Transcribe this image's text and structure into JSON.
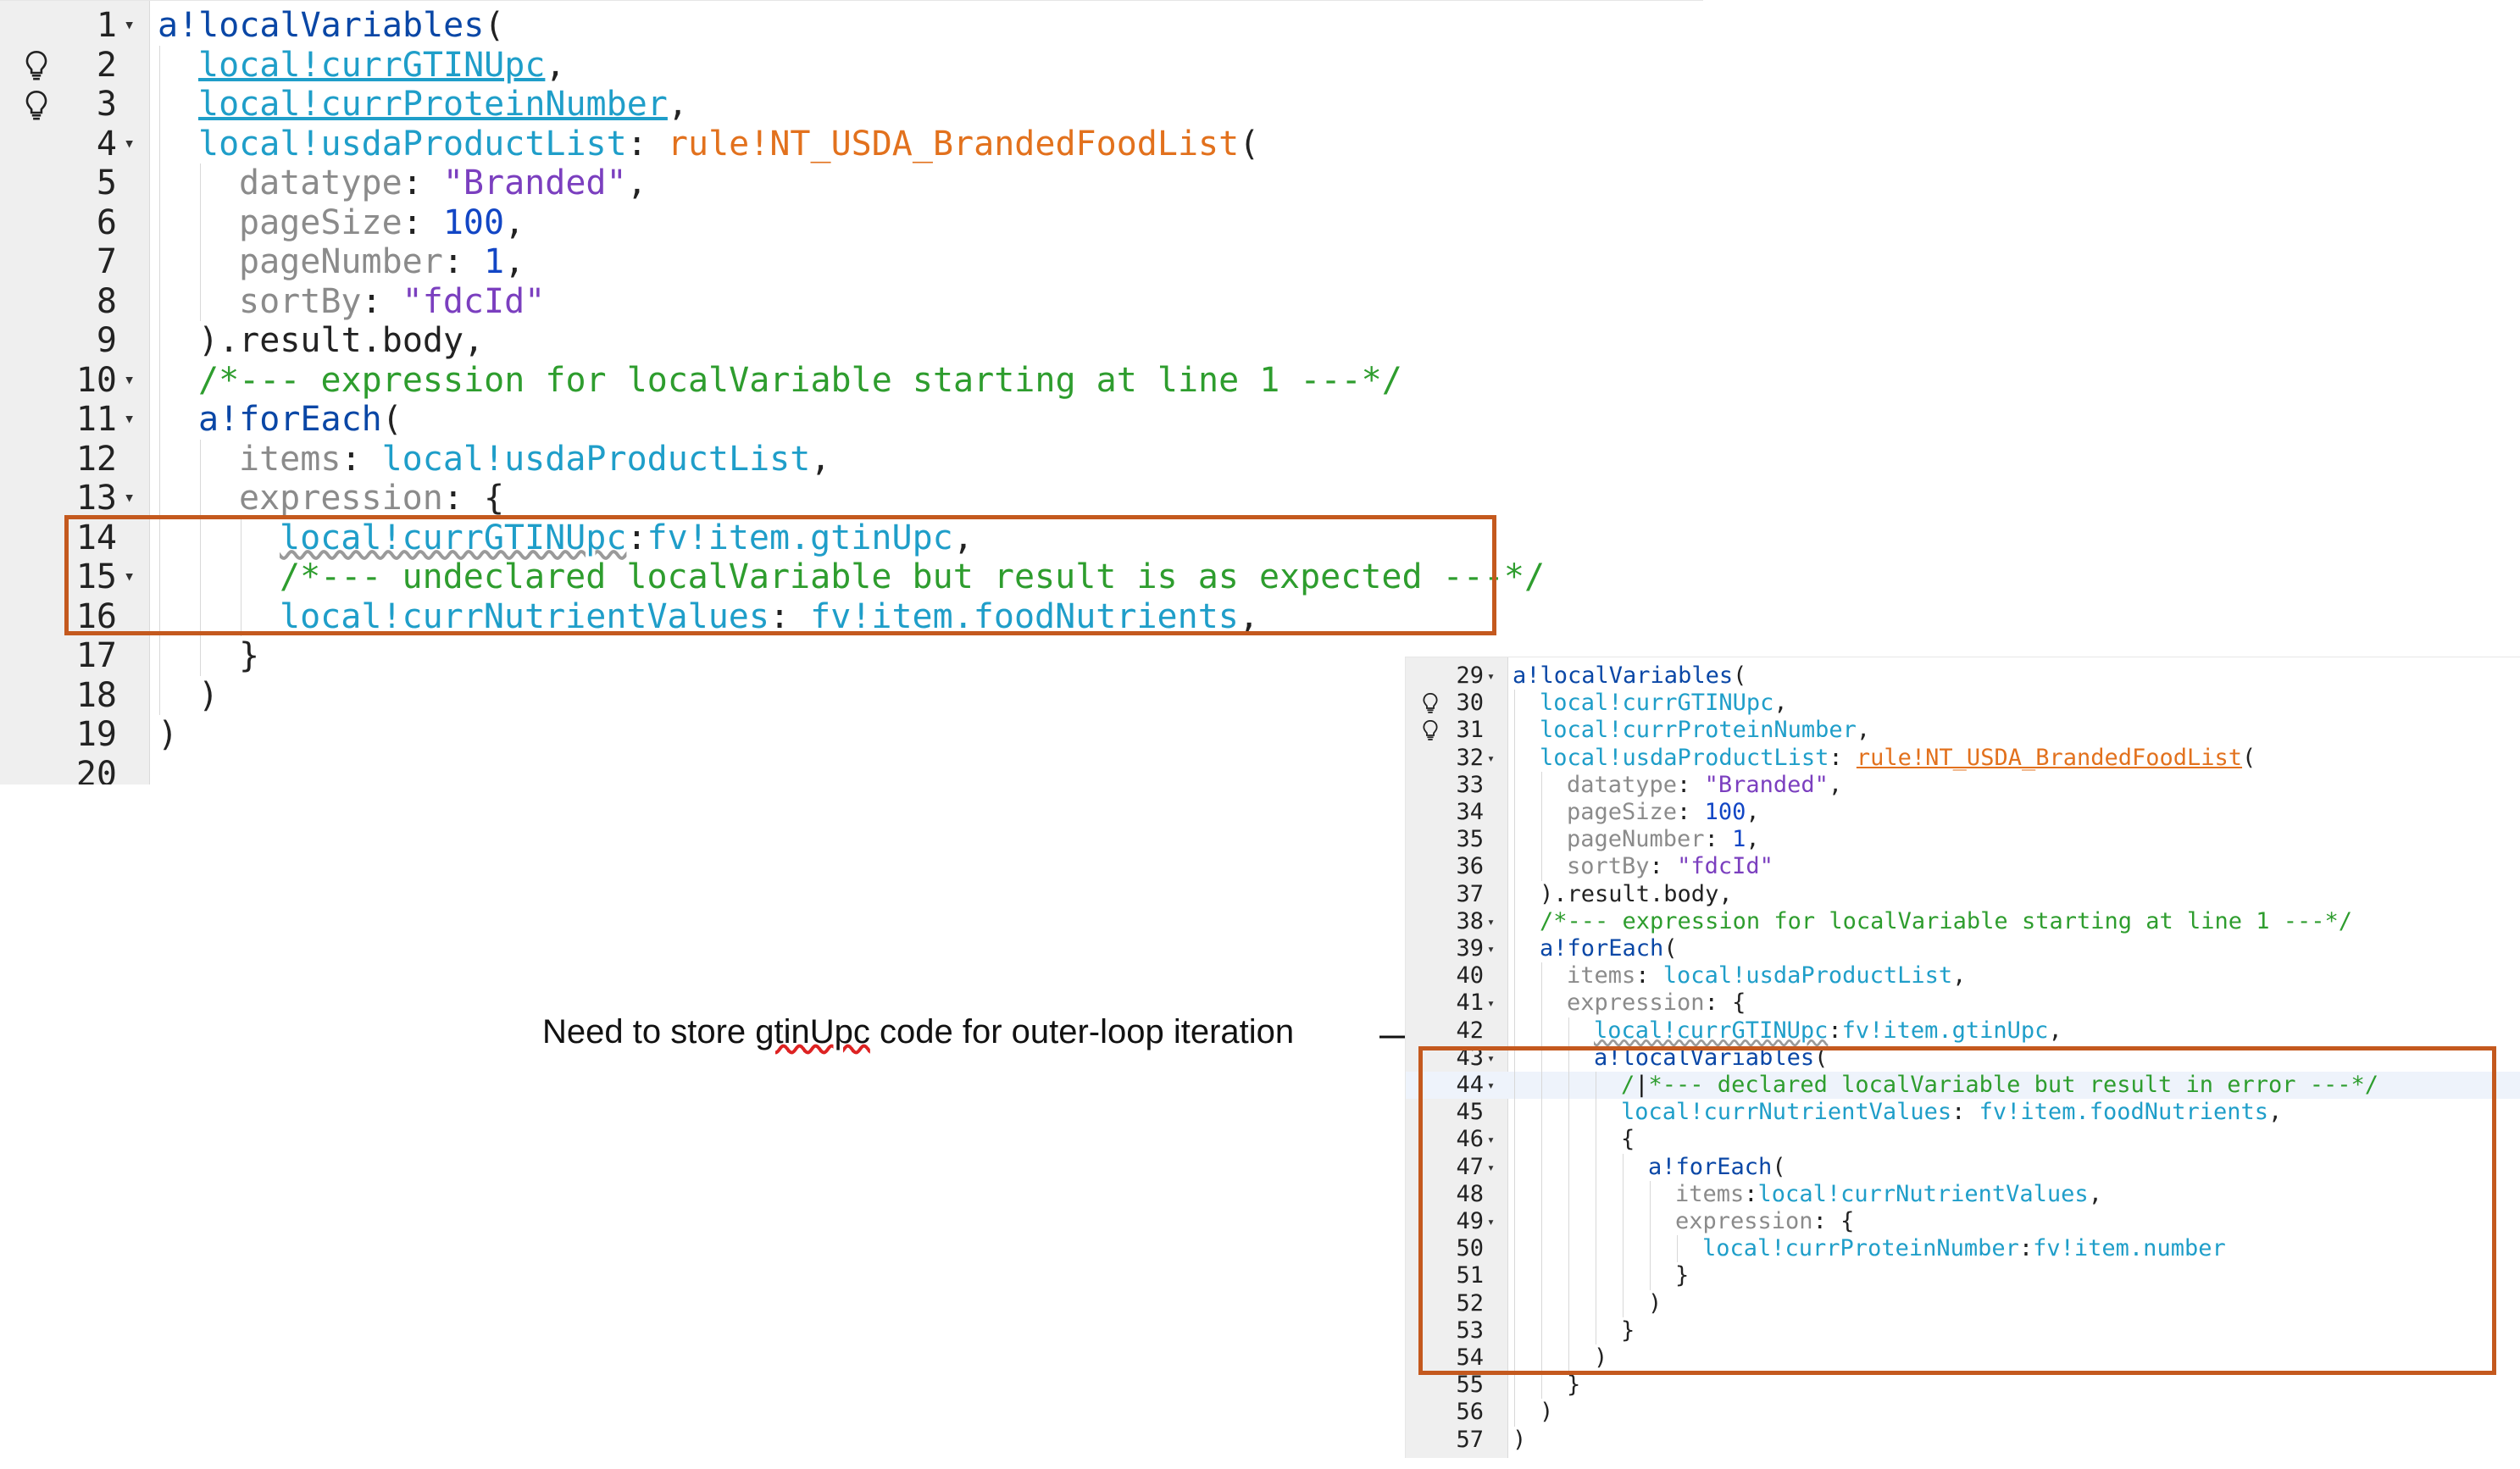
{
  "editor_top": {
    "lines": [
      {
        "n": "1",
        "fold": true,
        "bulb": false,
        "indent": 0,
        "t": [
          [
            "kw",
            "a!localVariables"
          ],
          [
            "txt",
            "("
          ]
        ]
      },
      {
        "n": "2",
        "fold": false,
        "bulb": true,
        "indent": 1,
        "t": [
          [
            "lv-ul",
            "local!currGTINUpc"
          ],
          [
            "txt",
            ","
          ]
        ]
      },
      {
        "n": "3",
        "fold": false,
        "bulb": true,
        "indent": 1,
        "t": [
          [
            "lv-ul",
            "local!currProteinNumber"
          ],
          [
            "txt",
            ","
          ]
        ]
      },
      {
        "n": "4",
        "fold": true,
        "bulb": false,
        "indent": 1,
        "t": [
          [
            "lv",
            "local!usdaProductList"
          ],
          [
            "txt",
            ": "
          ],
          [
            "rule",
            "rule!NT_USDA_BrandedFoodList"
          ],
          [
            "txt",
            "("
          ]
        ]
      },
      {
        "n": "5",
        "fold": false,
        "bulb": false,
        "indent": 2,
        "t": [
          [
            "param",
            "datatype"
          ],
          [
            "txt",
            ": "
          ],
          [
            "str",
            "\"Branded\""
          ],
          [
            "txt",
            ","
          ]
        ]
      },
      {
        "n": "6",
        "fold": false,
        "bulb": false,
        "indent": 2,
        "t": [
          [
            "param",
            "pageSize"
          ],
          [
            "txt",
            ": "
          ],
          [
            "num",
            "100"
          ],
          [
            "txt",
            ","
          ]
        ]
      },
      {
        "n": "7",
        "fold": false,
        "bulb": false,
        "indent": 2,
        "t": [
          [
            "param",
            "pageNumber"
          ],
          [
            "txt",
            ": "
          ],
          [
            "num",
            "1"
          ],
          [
            "txt",
            ","
          ]
        ]
      },
      {
        "n": "8",
        "fold": false,
        "bulb": false,
        "indent": 2,
        "t": [
          [
            "param",
            "sortBy"
          ],
          [
            "txt",
            ": "
          ],
          [
            "str",
            "\"fdcId\""
          ]
        ]
      },
      {
        "n": "9",
        "fold": false,
        "bulb": false,
        "indent": 1,
        "t": [
          [
            "txt",
            ").result.body,"
          ]
        ]
      },
      {
        "n": "10",
        "fold": true,
        "bulb": false,
        "indent": 1,
        "t": [
          [
            "cm",
            "/*--- expression for localVariable starting at line 1 ---*/"
          ]
        ]
      },
      {
        "n": "11",
        "fold": true,
        "bulb": false,
        "indent": 1,
        "t": [
          [
            "kw",
            "a!forEach"
          ],
          [
            "txt",
            "("
          ]
        ]
      },
      {
        "n": "12",
        "fold": false,
        "bulb": false,
        "indent": 2,
        "t": [
          [
            "param",
            "items"
          ],
          [
            "txt",
            ": "
          ],
          [
            "lv",
            "local!usdaProductList"
          ],
          [
            "txt",
            ","
          ]
        ]
      },
      {
        "n": "13",
        "fold": true,
        "bulb": false,
        "indent": 2,
        "t": [
          [
            "param",
            "expression"
          ],
          [
            "txt",
            ": {"
          ]
        ]
      },
      {
        "n": "14",
        "fold": false,
        "bulb": false,
        "indent": 3,
        "t": [
          [
            "lv-wavy",
            "local!currGTINUpc"
          ],
          [
            "txt",
            ":"
          ],
          [
            "lv",
            "fv!item.gtinUpc"
          ],
          [
            "txt",
            ","
          ]
        ]
      },
      {
        "n": "15",
        "fold": true,
        "bulb": false,
        "indent": 3,
        "t": [
          [
            "cm",
            "/*--- undeclared localVariable but result is as expected ---*/"
          ]
        ]
      },
      {
        "n": "16",
        "fold": false,
        "bulb": false,
        "indent": 3,
        "t": [
          [
            "lv",
            "local!currNutrientValues"
          ],
          [
            "txt",
            ": "
          ],
          [
            "lv",
            "fv!item.foodNutrients"
          ],
          [
            "txt",
            ","
          ]
        ]
      },
      {
        "n": "17",
        "fold": false,
        "bulb": false,
        "indent": 2,
        "t": [
          [
            "txt",
            "}"
          ]
        ]
      },
      {
        "n": "18",
        "fold": false,
        "bulb": false,
        "indent": 1,
        "t": [
          [
            "txt",
            ")"
          ]
        ]
      },
      {
        "n": "19",
        "fold": false,
        "bulb": false,
        "indent": 0,
        "t": [
          [
            "txt",
            ")"
          ]
        ]
      },
      {
        "n": "20",
        "fold": false,
        "bulb": false,
        "indent": 0,
        "t": []
      }
    ]
  },
  "editor_bottom": {
    "lines": [
      {
        "n": "29",
        "fold": true,
        "bulb": false,
        "indent": 0,
        "t": [
          [
            "kw",
            "a!localVariables"
          ],
          [
            "txt",
            "("
          ]
        ]
      },
      {
        "n": "30",
        "fold": false,
        "bulb": true,
        "indent": 1,
        "t": [
          [
            "lv",
            "local!currGTINUpc"
          ],
          [
            "txt",
            ","
          ]
        ]
      },
      {
        "n": "31",
        "fold": false,
        "bulb": true,
        "indent": 1,
        "t": [
          [
            "lv",
            "local!currProteinNumber"
          ],
          [
            "txt",
            ","
          ]
        ]
      },
      {
        "n": "32",
        "fold": true,
        "bulb": false,
        "indent": 1,
        "t": [
          [
            "lv",
            "local!usdaProductList"
          ],
          [
            "txt",
            ": "
          ],
          [
            "rule-ul",
            "rule!NT_USDA_BrandedFoodList"
          ],
          [
            "txt",
            "("
          ]
        ]
      },
      {
        "n": "33",
        "fold": false,
        "bulb": false,
        "indent": 2,
        "t": [
          [
            "param",
            "datatype"
          ],
          [
            "txt",
            ": "
          ],
          [
            "str",
            "\"Branded\""
          ],
          [
            "txt",
            ","
          ]
        ]
      },
      {
        "n": "34",
        "fold": false,
        "bulb": false,
        "indent": 2,
        "t": [
          [
            "param",
            "pageSize"
          ],
          [
            "txt",
            ": "
          ],
          [
            "num",
            "100"
          ],
          [
            "txt",
            ","
          ]
        ]
      },
      {
        "n": "35",
        "fold": false,
        "bulb": false,
        "indent": 2,
        "t": [
          [
            "param",
            "pageNumber"
          ],
          [
            "txt",
            ": "
          ],
          [
            "num",
            "1"
          ],
          [
            "txt",
            ","
          ]
        ]
      },
      {
        "n": "36",
        "fold": false,
        "bulb": false,
        "indent": 2,
        "t": [
          [
            "param",
            "sortBy"
          ],
          [
            "txt",
            ": "
          ],
          [
            "str",
            "\"fdcId\""
          ]
        ]
      },
      {
        "n": "37",
        "fold": false,
        "bulb": false,
        "indent": 1,
        "t": [
          [
            "txt",
            ").result.body,"
          ]
        ]
      },
      {
        "n": "38",
        "fold": true,
        "bulb": false,
        "indent": 1,
        "t": [
          [
            "cm",
            "/*--- expression for localVariable starting at line 1 ---*/"
          ]
        ]
      },
      {
        "n": "39",
        "fold": true,
        "bulb": false,
        "indent": 1,
        "t": [
          [
            "kw",
            "a!forEach"
          ],
          [
            "txt",
            "("
          ]
        ]
      },
      {
        "n": "40",
        "fold": false,
        "bulb": false,
        "indent": 2,
        "t": [
          [
            "param",
            "items"
          ],
          [
            "txt",
            ": "
          ],
          [
            "lv",
            "local!usdaProductList"
          ],
          [
            "txt",
            ","
          ]
        ]
      },
      {
        "n": "41",
        "fold": true,
        "bulb": false,
        "indent": 2,
        "t": [
          [
            "param",
            "expression"
          ],
          [
            "txt",
            ": {"
          ]
        ]
      },
      {
        "n": "42",
        "fold": false,
        "bulb": false,
        "indent": 3,
        "t": [
          [
            "lv-wavy",
            "local!currGTINUpc"
          ],
          [
            "txt",
            ":"
          ],
          [
            "lv",
            "fv!item.gtinUpc"
          ],
          [
            "txt",
            ","
          ]
        ]
      },
      {
        "n": "43",
        "fold": true,
        "bulb": false,
        "indent": 3,
        "t": [
          [
            "kw",
            "a!localVariables"
          ],
          [
            "txt",
            "("
          ]
        ]
      },
      {
        "n": "44",
        "fold": true,
        "bulb": false,
        "indent": 4,
        "hl": true,
        "t": [
          [
            "cm",
            "/"
          ],
          [
            "cursor",
            "|"
          ],
          [
            "cm",
            "*--- declared localVariable but result in error ---*/"
          ]
        ]
      },
      {
        "n": "45",
        "fold": false,
        "bulb": false,
        "indent": 4,
        "t": [
          [
            "lv",
            "local!currNutrientValues"
          ],
          [
            "txt",
            ": "
          ],
          [
            "lv",
            "fv!item.foodNutrients"
          ],
          [
            "txt",
            ","
          ]
        ]
      },
      {
        "n": "46",
        "fold": true,
        "bulb": false,
        "indent": 4,
        "t": [
          [
            "txt",
            "{"
          ]
        ]
      },
      {
        "n": "47",
        "fold": true,
        "bulb": false,
        "indent": 5,
        "t": [
          [
            "kw",
            "a!forEach"
          ],
          [
            "txt",
            "("
          ]
        ]
      },
      {
        "n": "48",
        "fold": false,
        "bulb": false,
        "indent": 6,
        "t": [
          [
            "param",
            "items"
          ],
          [
            "txt",
            ":"
          ],
          [
            "lv",
            "local!currNutrientValues"
          ],
          [
            "txt",
            ","
          ]
        ]
      },
      {
        "n": "49",
        "fold": true,
        "bulb": false,
        "indent": 6,
        "t": [
          [
            "param",
            "expression"
          ],
          [
            "txt",
            ": {"
          ]
        ]
      },
      {
        "n": "50",
        "fold": false,
        "bulb": false,
        "indent": 7,
        "t": [
          [
            "lv",
            "local!currProteinNumber"
          ],
          [
            "txt",
            ":"
          ],
          [
            "lv",
            "fv!item.number"
          ]
        ]
      },
      {
        "n": "51",
        "fold": false,
        "bulb": false,
        "indent": 6,
        "t": [
          [
            "txt",
            "}"
          ]
        ]
      },
      {
        "n": "52",
        "fold": false,
        "bulb": false,
        "indent": 5,
        "t": [
          [
            "txt",
            ")"
          ]
        ]
      },
      {
        "n": "53",
        "fold": false,
        "bulb": false,
        "indent": 4,
        "t": [
          [
            "txt",
            "}"
          ]
        ]
      },
      {
        "n": "54",
        "fold": false,
        "bulb": false,
        "indent": 3,
        "t": [
          [
            "txt",
            ")"
          ]
        ]
      },
      {
        "n": "55",
        "fold": false,
        "bulb": false,
        "indent": 2,
        "t": [
          [
            "txt",
            "}"
          ]
        ]
      },
      {
        "n": "56",
        "fold": false,
        "bulb": false,
        "indent": 1,
        "t": [
          [
            "txt",
            ")"
          ]
        ]
      },
      {
        "n": "57",
        "fold": false,
        "bulb": false,
        "indent": 0,
        "t": [
          [
            "txt",
            ")"
          ]
        ]
      }
    ]
  },
  "annotation": {
    "before": "Need to store ",
    "misspelled": "gtinUpc",
    "after": " code for outer-loop iteration"
  },
  "colors": {
    "highlight_box": "#c4591e",
    "keyword": "#0a47a6",
    "local_variable": "#1f9ec9",
    "rule": "#e2711d",
    "comment": "#2e9d2e",
    "string": "#7b3fbf",
    "number": "#1246c5",
    "parameter": "#8b8b8b"
  }
}
